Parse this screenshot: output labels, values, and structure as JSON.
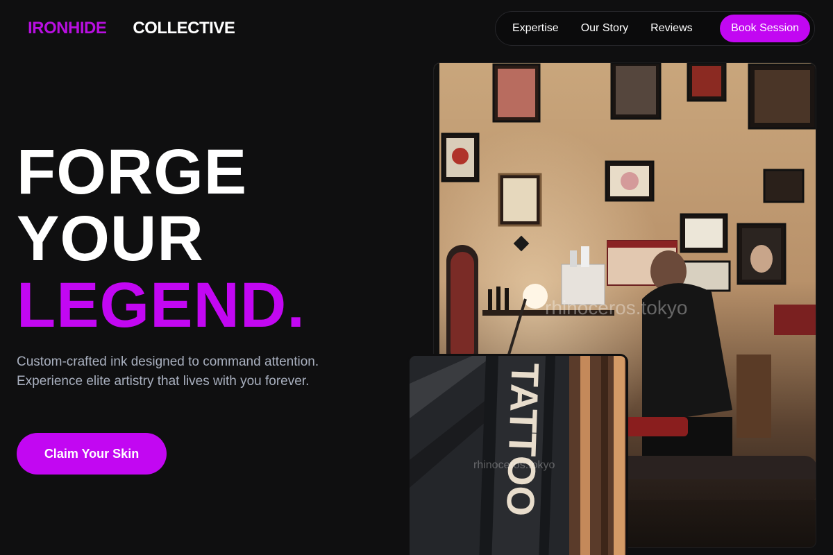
{
  "header": {
    "brand_primary": "IRONHIDE",
    "brand_secondary": "COLLECTIVE",
    "nav": [
      "Expertise",
      "Our Story",
      "Reviews"
    ],
    "cta": "Book Session"
  },
  "hero": {
    "line1": "FORGE",
    "line2": "YOUR",
    "line3": "LEGEND.",
    "subcopy": "Custom-crafted ink designed to command attention. Experience elite artistry that lives with you forever.",
    "cta": "Claim Your Skin"
  },
  "images": {
    "main_watermark": "rhinoceros.tokyo",
    "secondary_sign": "TATTOO",
    "secondary_watermark": "rhinoceros.tokyo"
  },
  "colors": {
    "accent": "#c207f2",
    "background": "#0f0f10",
    "body_text": "#a9b0bf"
  }
}
